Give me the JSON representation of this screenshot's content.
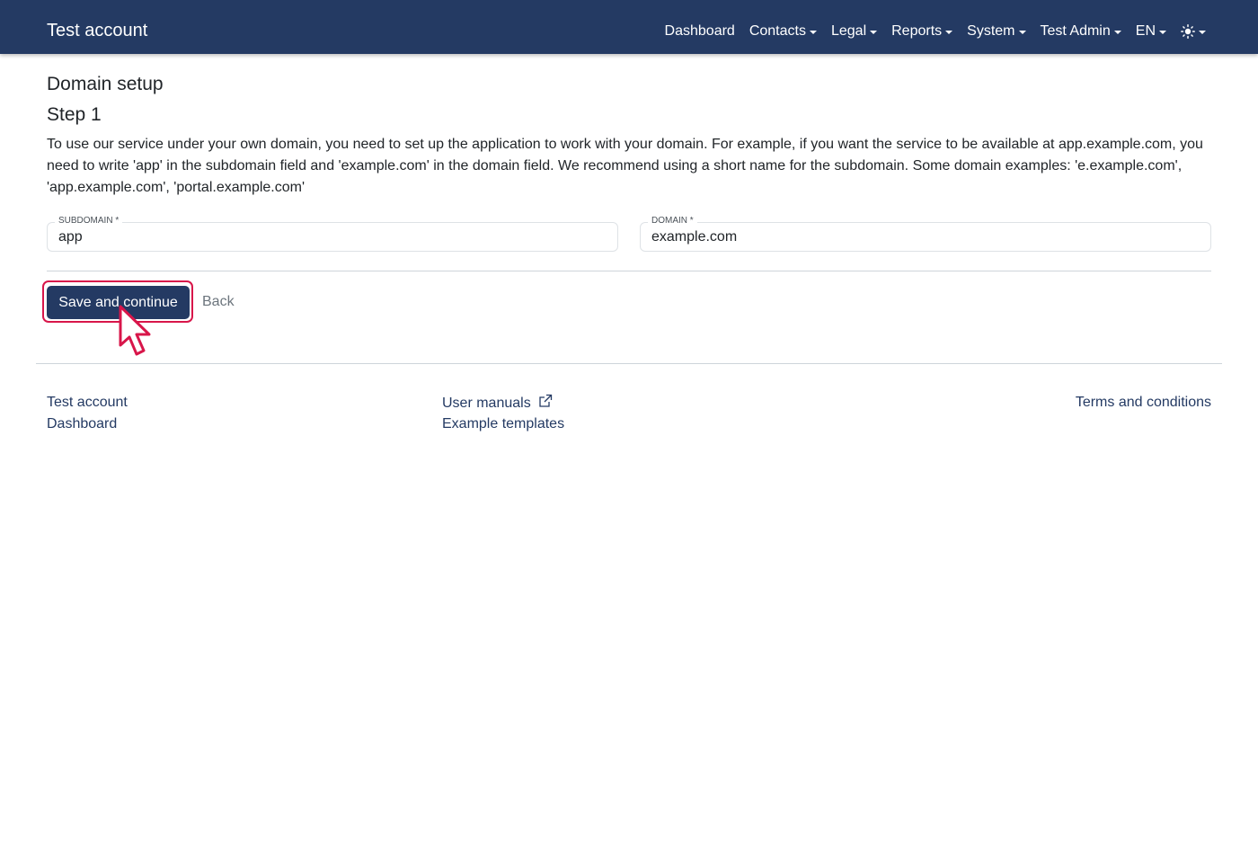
{
  "header": {
    "brand": "Test account",
    "nav": [
      {
        "label": "Dashboard",
        "dropdown": false
      },
      {
        "label": "Contacts",
        "dropdown": true
      },
      {
        "label": "Legal",
        "dropdown": true
      },
      {
        "label": "Reports",
        "dropdown": true
      },
      {
        "label": "System",
        "dropdown": true
      },
      {
        "label": "Test Admin",
        "dropdown": true
      },
      {
        "label": "EN",
        "dropdown": true
      }
    ],
    "theme_icon": "sun-icon"
  },
  "main": {
    "title": "Domain setup",
    "step": "Step 1",
    "intro": "To use our service under your own domain, you need to set up the application to work with your domain. For example, if you want the service to be available at app.example.com, you need to write 'app' in the subdomain field and 'example.com' in the domain field. We recommend using a short name for the subdomain. Some domain examples: 'e.example.com', 'app.example.com', 'portal.example.com'",
    "fields": {
      "subdomain": {
        "label": "SUBDOMAIN *",
        "value": "app"
      },
      "domain": {
        "label": "DOMAIN *",
        "value": "example.com"
      }
    },
    "save_label": "Save and continue",
    "back_label": "Back"
  },
  "footer": {
    "col1": [
      "Test account",
      "Dashboard"
    ],
    "col2": [
      "User manuals",
      "Example templates"
    ],
    "terms": "Terms and conditions"
  },
  "colors": {
    "primary": "#243a63",
    "highlight": "#d8164a"
  }
}
